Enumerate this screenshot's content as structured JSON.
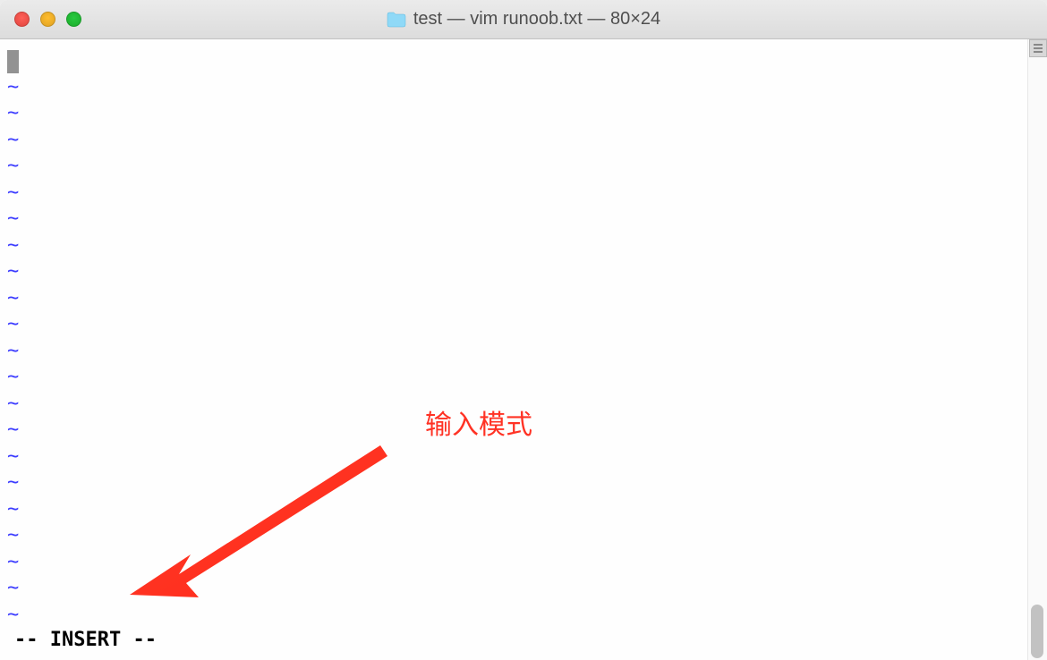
{
  "titlebar": {
    "title": "test — vim runoob.txt — 80×24"
  },
  "editor": {
    "tilde": "~",
    "tilde_count": 21,
    "status_text": "-- INSERT --"
  },
  "annotation": {
    "label": "输入模式"
  }
}
